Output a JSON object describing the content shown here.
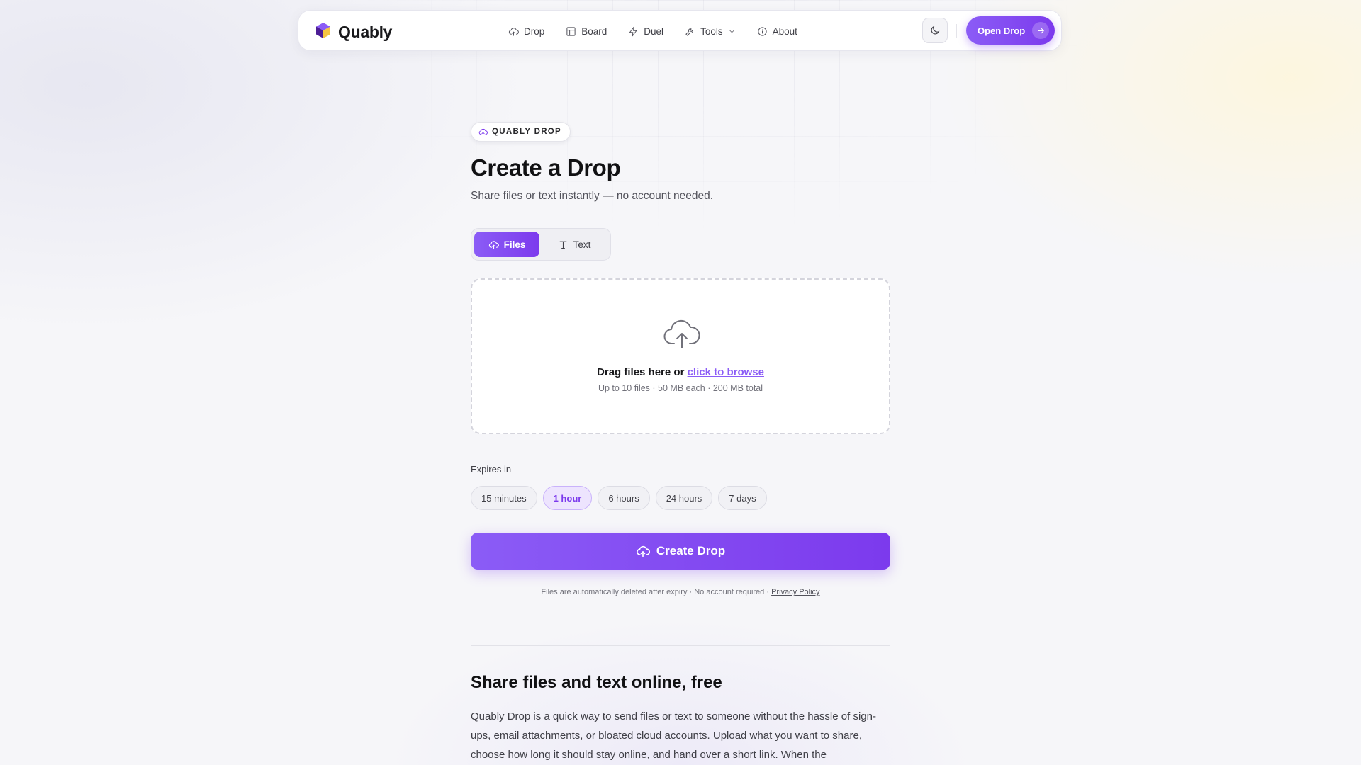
{
  "colors": {
    "accent": "#7c3aed",
    "accent_light": "#8b5cf6",
    "chip_selected_bg": "#ede4fe",
    "background": "#f6f6f9"
  },
  "header": {
    "brand": "Quably",
    "nav": [
      {
        "label": "Drop",
        "icon": "cloud-upload-icon"
      },
      {
        "label": "Board",
        "icon": "board-icon"
      },
      {
        "label": "Duel",
        "icon": "bolt-icon"
      },
      {
        "label": "Tools",
        "icon": "wrench-icon",
        "has_dropdown": true
      },
      {
        "label": "About",
        "icon": "info-icon"
      }
    ],
    "theme_toggle_icon": "moon-icon",
    "cta_label": "Open Drop"
  },
  "hero": {
    "badge": "QUABLY DROP",
    "title": "Create a Drop",
    "subtitle": "Share files or text instantly — no account needed."
  },
  "mode_tabs": [
    {
      "label": "Files",
      "icon": "cloud-upload-icon",
      "active": true
    },
    {
      "label": "Text",
      "icon": "text-icon",
      "active": false
    }
  ],
  "dropzone": {
    "prompt": "Drag files here or",
    "browse_link": "click to browse",
    "limits": "Up to 10 files · 50 MB each · 200 MB total"
  },
  "expiry": {
    "label": "Expires in",
    "options": [
      "15 minutes",
      "1 hour",
      "6 hours",
      "24 hours",
      "7 days"
    ],
    "selected": "1 hour"
  },
  "create_button": "Create Drop",
  "footnote": {
    "text": "Files are automatically deleted after expiry · No account required ·",
    "link": "Privacy Policy"
  },
  "info_section": {
    "title": "Share files and text online, free",
    "body": "Quably Drop is a quick way to send files or text to someone without the hassle of sign-ups, email attachments, or bloated cloud accounts. Upload what you want to share, choose how long it should stay online, and hand over a short link. When the"
  }
}
